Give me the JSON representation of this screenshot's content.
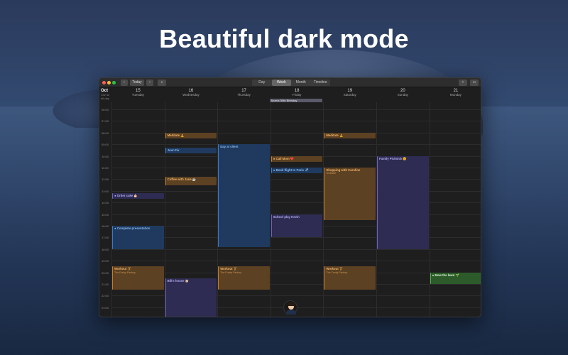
{
  "headline": "Beautiful dark mode",
  "toolbar": {
    "back_icon": "chevron-left-icon",
    "today_label": "Today",
    "forward_icon": "chevron-right-icon",
    "search_icon": "search-icon",
    "views": [
      "Day",
      "Week",
      "Month",
      "Timeline"
    ],
    "active_view": "Week",
    "add_icon": "plus-icon",
    "sidebar_icon": "sidebar-icon"
  },
  "header": {
    "month": "Oct",
    "week_label": "CW 42",
    "all_day_label": "all-day",
    "days": [
      {
        "num": "15",
        "name": "Tuesday"
      },
      {
        "num": "16",
        "name": "Wednesday"
      },
      {
        "num": "17",
        "name": "Thursday"
      },
      {
        "num": "18",
        "name": "Friday"
      },
      {
        "num": "19",
        "name": "Saturday"
      },
      {
        "num": "20",
        "name": "Sunday"
      },
      {
        "num": "21",
        "name": "Monday"
      }
    ],
    "all_day_event": "Mom's 50th Birthday"
  },
  "hours": [
    "06:00",
    "07:00",
    "08:00",
    "09:00",
    "10:00",
    "11:00",
    "12:00",
    "13:00",
    "14:00",
    "15:00",
    "16:00",
    "17:00",
    "18:00",
    "19:00",
    "20:00",
    "21:00",
    "22:00",
    "23:00"
  ],
  "events": [
    {
      "day": 0,
      "start": 13.2,
      "end": 13.7,
      "title": "Order cake 🎂",
      "sub": "",
      "color": "purple",
      "dot": true
    },
    {
      "day": 0,
      "start": 16.0,
      "end": 18.0,
      "title": "Complete presentation",
      "sub": "",
      "color": "blue",
      "dot": true
    },
    {
      "day": 0,
      "start": 19.5,
      "end": 21.5,
      "title": "Workout 🏋",
      "sub": "The Funky Factory",
      "color": "orange",
      "dot": false
    },
    {
      "day": 1,
      "start": 8.0,
      "end": 8.5,
      "title": "Meditate 🧘",
      "sub": "",
      "color": "orange",
      "dot": false
    },
    {
      "day": 1,
      "start": 9.3,
      "end": 9.8,
      "title": "Jour-Fix",
      "sub": "",
      "color": "blue",
      "dot": false
    },
    {
      "day": 1,
      "start": 11.8,
      "end": 12.5,
      "title": "Coffee with Jane ☕",
      "sub": "",
      "color": "orange",
      "dot": false
    },
    {
      "day": 1,
      "start": 20.5,
      "end": 24.0,
      "title": "Bill's house 🏠",
      "sub": "",
      "color": "purple",
      "dot": false
    },
    {
      "day": 2,
      "start": 9.0,
      "end": 17.8,
      "title": "Day at client",
      "sub": "",
      "color": "blue",
      "dot": false
    },
    {
      "day": 2,
      "start": 19.5,
      "end": 21.5,
      "title": "Workout 🏋",
      "sub": "The Funky Factory",
      "color": "orange",
      "dot": false
    },
    {
      "day": 3,
      "start": 10.0,
      "end": 10.5,
      "title": "Call Mom ❤️",
      "sub": "",
      "color": "orange",
      "dot": true
    },
    {
      "day": 3,
      "start": 11.0,
      "end": 11.5,
      "title": "Book flight to Paris ✈️",
      "sub": "",
      "color": "blue",
      "dot": true
    },
    {
      "day": 3,
      "start": 15.0,
      "end": 17.0,
      "title": "School play Kevin",
      "sub": "",
      "color": "purple",
      "dot": false
    },
    {
      "day": 4,
      "start": 8.0,
      "end": 8.5,
      "title": "Meditate 🧘",
      "sub": "",
      "color": "orange",
      "dot": false
    },
    {
      "day": 4,
      "start": 11.0,
      "end": 15.5,
      "title": "Shopping with Caroline",
      "sub": "Wolfdale",
      "color": "orange",
      "dot": false
    },
    {
      "day": 4,
      "start": 19.5,
      "end": 21.5,
      "title": "Workout 🏋",
      "sub": "The Funky Factory",
      "color": "orange",
      "dot": false
    },
    {
      "day": 5,
      "start": 10.0,
      "end": 18.0,
      "title": "Family Picknick 🌞",
      "sub": "",
      "color": "purple",
      "dot": false
    },
    {
      "day": 6,
      "start": 20.0,
      "end": 21.0,
      "title": "Mow the lawn 🌱",
      "sub": "",
      "color": "green",
      "dot": true
    }
  ],
  "colors": {
    "orange": {
      "bg": "#5c4122",
      "border": "#c47c2c",
      "text": "#f0b46a"
    },
    "blue": {
      "bg": "#1f3a5e",
      "border": "#3d7bc7",
      "text": "#8ab8f0"
    },
    "purple": {
      "bg": "#2e2c52",
      "border": "#6a62c4",
      "text": "#b3adf2"
    },
    "green": {
      "bg": "#2c5a2a",
      "border": "#4fb04a",
      "text": "#d7f5d2"
    }
  },
  "avatar_icon": "user-avatar-icon"
}
